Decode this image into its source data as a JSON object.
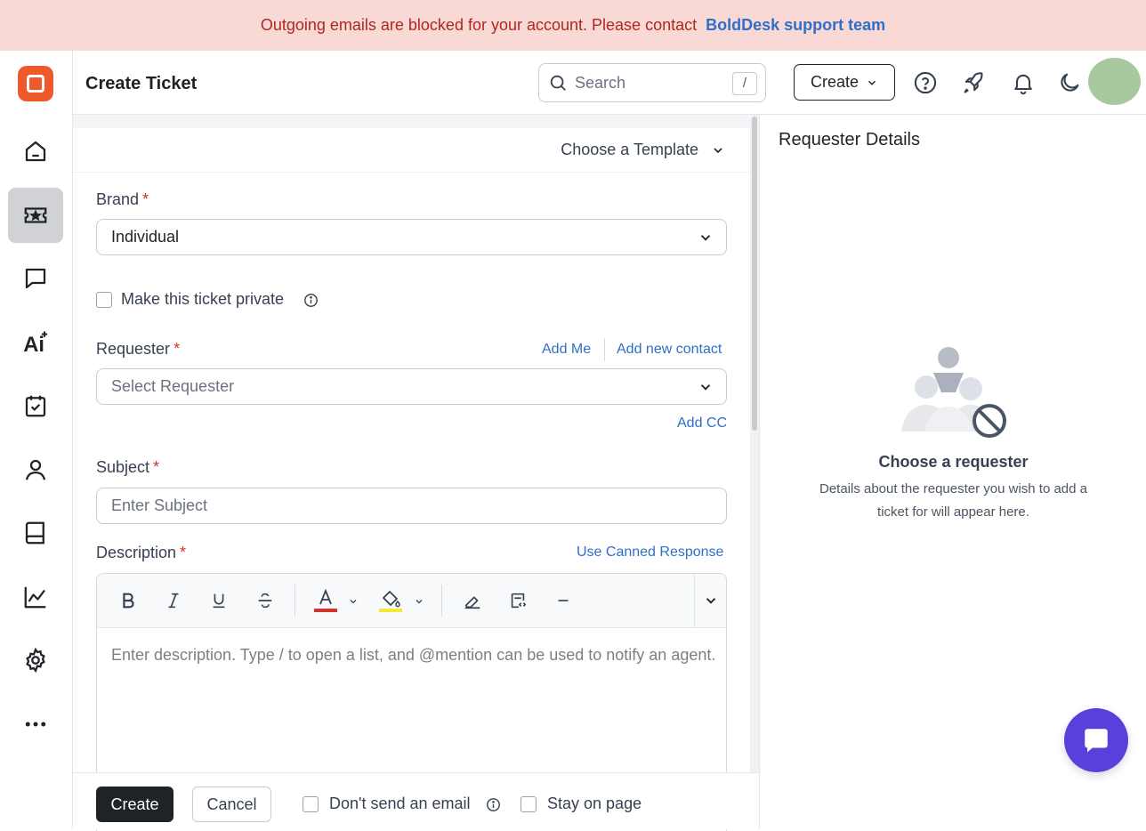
{
  "banner": {
    "message": "Outgoing emails are blocked for your account. Please contact",
    "link": "BoldDesk support team"
  },
  "header": {
    "title": "Create Ticket",
    "search_placeholder": "Search",
    "search_shortcut": "/",
    "create_label": "Create"
  },
  "sidebar": {
    "items": [
      {
        "name": "home",
        "icon": "home-icon"
      },
      {
        "name": "tickets",
        "icon": "ticket-icon",
        "active": true
      },
      {
        "name": "chat",
        "icon": "chat-icon"
      },
      {
        "name": "ai",
        "icon": "ai-icon"
      },
      {
        "name": "tasks",
        "icon": "calendar-check-icon"
      },
      {
        "name": "contacts",
        "icon": "person-icon"
      },
      {
        "name": "knowledge-base",
        "icon": "book-icon"
      },
      {
        "name": "reports",
        "icon": "chart-icon"
      },
      {
        "name": "settings",
        "icon": "gear-icon"
      },
      {
        "name": "more",
        "icon": "more-icon"
      }
    ]
  },
  "form": {
    "template_label": "Choose a Template",
    "brand_label": "Brand",
    "brand_value": "Individual",
    "private_label": "Make this ticket private",
    "requester_label": "Requester",
    "add_me": "Add Me",
    "add_new_contact": "Add new contact",
    "requester_placeholder": "Select Requester",
    "add_cc": "Add CC",
    "subject_label": "Subject",
    "subject_placeholder": "Enter Subject",
    "description_label": "Description",
    "canned_response": "Use Canned Response",
    "description_placeholder": "Enter description. Type / to open a list, and @mention can be used to notify an agent."
  },
  "footer": {
    "create_label": "Create",
    "cancel_label": "Cancel",
    "dont_send_email": "Don't send an email",
    "stay_on_page": "Stay on page"
  },
  "requester_panel": {
    "title": "Requester Details",
    "empty_title": "Choose a requester",
    "empty_desc": "Details about the requester you wish to add a ticket for will appear here."
  },
  "colors": {
    "banner_bg": "#f8d9d5",
    "banner_text": "#b0271e",
    "link": "#2f6fc9",
    "brand_orange": "#ef5a2b",
    "chat_fab": "#5b3fdc",
    "required": "#d0342c"
  }
}
